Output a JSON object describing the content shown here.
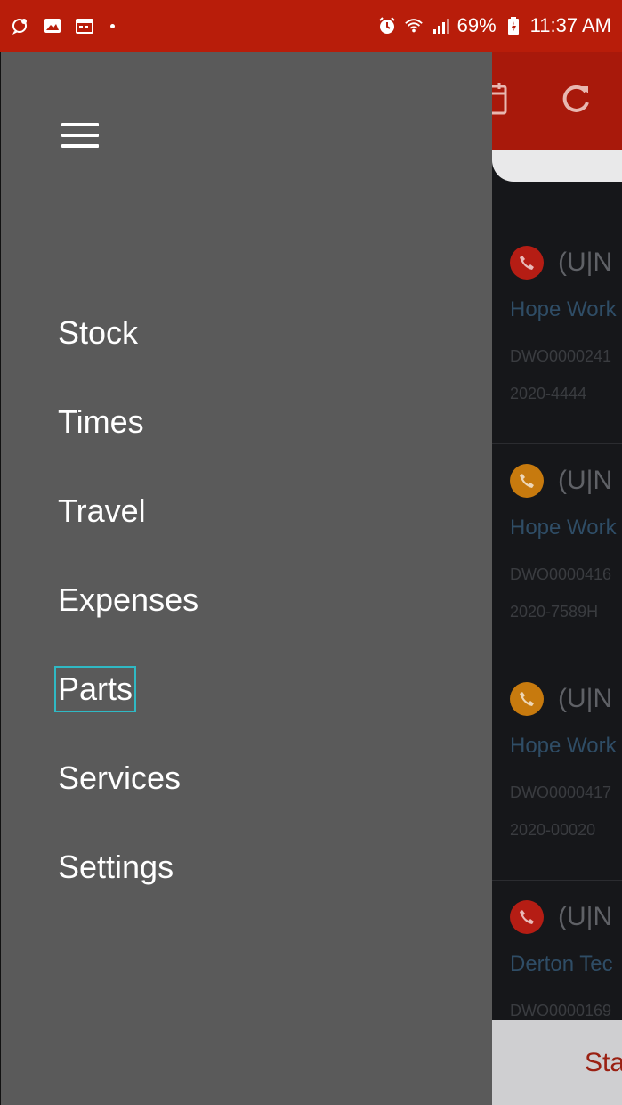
{
  "status_bar": {
    "battery": "69%",
    "time": "11:37 AM",
    "icons_left": [
      "chat-bubble-icon",
      "image-icon",
      "calendar-icon"
    ],
    "icons_right": [
      "alarm-icon",
      "wifi-icon",
      "signal-icon",
      "battery-icon"
    ]
  },
  "drawer": {
    "menu_items": [
      {
        "label": "Stock"
      },
      {
        "label": "Times"
      },
      {
        "label": "Travel"
      },
      {
        "label": "Expenses"
      },
      {
        "label": "Parts",
        "selected": true
      },
      {
        "label": "Services"
      },
      {
        "label": "Settings"
      }
    ]
  },
  "background": {
    "toolbar_icons": [
      "calendar-icon",
      "refresh-icon"
    ],
    "jobs": [
      {
        "code": "(U|N",
        "company": "Hope Work",
        "dwo": "DWO0000241",
        "ref": "2020-4444",
        "priority": "red"
      },
      {
        "code": "(U|N",
        "company": "Hope Work",
        "dwo": "DWO0000416",
        "ref": "2020-7589H",
        "priority": "orange"
      },
      {
        "code": "(U|N",
        "company": "Hope Work",
        "dwo": "DWO0000417",
        "ref": "2020-00020",
        "priority": "orange"
      },
      {
        "code": "(U|N",
        "company": "Derton Tec",
        "dwo": "DWO0000169",
        "ref": "",
        "priority": "red"
      }
    ],
    "bottom_button": "Sta"
  },
  "colors": {
    "status_bar": "#b81d0a",
    "drawer": "#5a5a5a",
    "selection_outline": "#2fb9c4",
    "priority_red": "#b51d14",
    "priority_orange": "#c77a0e"
  }
}
